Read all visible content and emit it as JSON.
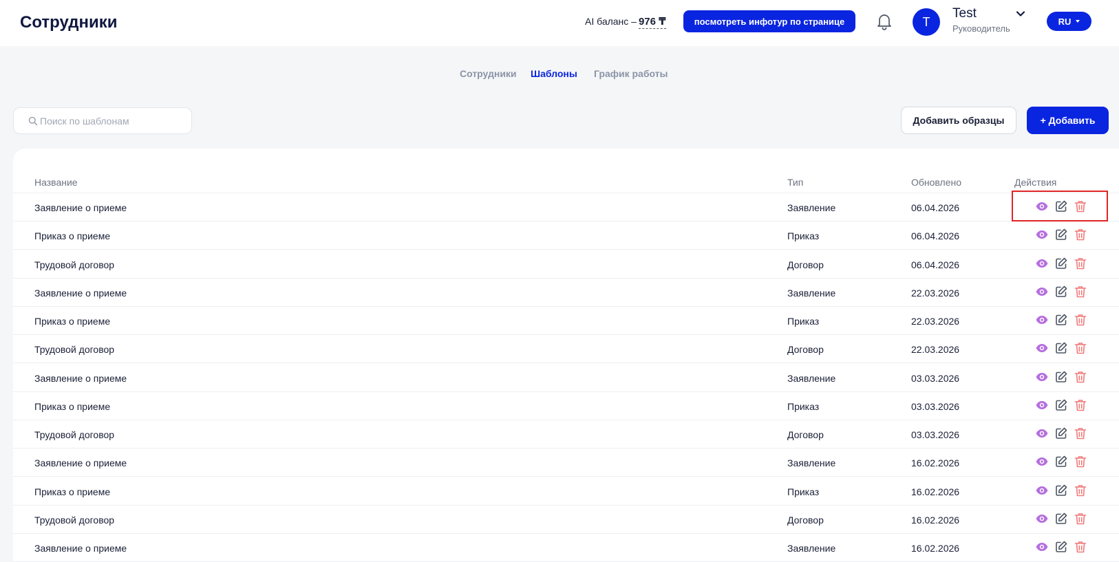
{
  "header": {
    "title": "Сотрудники",
    "balance_label": "AI баланс –",
    "balance_value": "976 ₸",
    "tour_button": "посмотреть инфотур по странице",
    "user": {
      "initial": "T",
      "name": "Test",
      "role": "Руководитель"
    },
    "language": "RU"
  },
  "tabs": [
    {
      "label": "Сотрудники",
      "active": false
    },
    {
      "label": "Шаблоны",
      "active": true
    },
    {
      "label": "График работы",
      "active": false
    }
  ],
  "search": {
    "placeholder": "Поиск по шаблонам",
    "value": ""
  },
  "buttons": {
    "add_samples": "Добавить образцы",
    "add": "+ Добавить"
  },
  "table": {
    "columns": {
      "name": "Название",
      "type": "Тип",
      "updated": "Обновлено",
      "actions": "Действия"
    },
    "rows": [
      {
        "name": "Заявление о приеме",
        "type": "Заявление",
        "updated": "06.04.2026"
      },
      {
        "name": "Приказ о приеме",
        "type": "Приказ",
        "updated": "06.04.2026"
      },
      {
        "name": "Трудовой договор",
        "type": "Договор",
        "updated": "06.04.2026"
      },
      {
        "name": "Заявление о приеме",
        "type": "Заявление",
        "updated": "22.03.2026"
      },
      {
        "name": "Приказ о приеме",
        "type": "Приказ",
        "updated": "22.03.2026"
      },
      {
        "name": "Трудовой договор",
        "type": "Договор",
        "updated": "22.03.2026"
      },
      {
        "name": "Заявление о приеме",
        "type": "Заявление",
        "updated": "03.03.2026"
      },
      {
        "name": "Приказ о приеме",
        "type": "Приказ",
        "updated": "03.03.2026"
      },
      {
        "name": "Трудовой договор",
        "type": "Договор",
        "updated": "03.03.2026"
      },
      {
        "name": "Заявление о приеме",
        "type": "Заявление",
        "updated": "16.02.2026"
      },
      {
        "name": "Приказ о приеме",
        "type": "Приказ",
        "updated": "16.02.2026"
      },
      {
        "name": "Трудовой договор",
        "type": "Договор",
        "updated": "16.02.2026"
      },
      {
        "name": "Заявление о приеме",
        "type": "Заявление",
        "updated": "16.02.2026"
      }
    ]
  },
  "icons": {
    "view": "eye-icon",
    "edit": "edit-icon",
    "delete": "trash-icon"
  },
  "colors": {
    "primary": "#0a25e0",
    "view_icon": "#b56ee0",
    "edit_icon": "#4b5563",
    "delete_icon": "#f07a7a",
    "highlight": "#e02424"
  }
}
